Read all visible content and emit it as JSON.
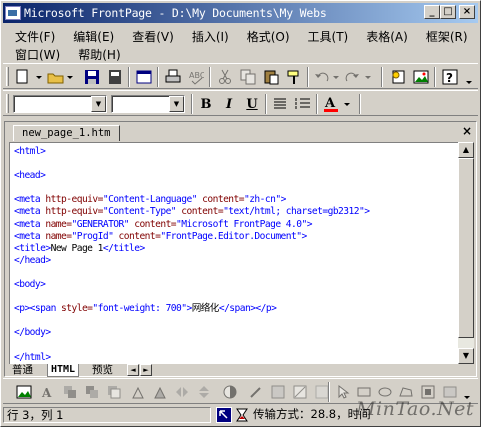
{
  "window": {
    "title": "Microsoft FrontPage - D:\\My Documents\\My Webs",
    "min_glyph": "_",
    "max_glyph": "□",
    "close_glyph": "×"
  },
  "menu": {
    "row1": [
      "文件(F)",
      "编辑(E)",
      "查看(V)",
      "插入(I)",
      "格式(O)",
      "工具(T)",
      "表格(A)",
      "框架(R)"
    ],
    "row2": [
      "窗口(W)",
      "帮助(H)"
    ]
  },
  "format_toolbar": {
    "style_value": "",
    "font_value": "",
    "bold": "B",
    "italic": "I",
    "underline": "U",
    "font_color_glyph": "A"
  },
  "document": {
    "tab_label": "new_page_1.htm",
    "close_glyph": "×",
    "code_lines": [
      [
        {
          "t": "tag",
          "v": "<html>"
        }
      ],
      [],
      [
        {
          "t": "tag",
          "v": "<head>"
        }
      ],
      [],
      [
        {
          "t": "tag",
          "v": "<meta "
        },
        {
          "t": "attr",
          "v": "http-equiv="
        },
        {
          "t": "val",
          "v": "\"Content-Language\""
        },
        {
          "t": "attr",
          "v": " content="
        },
        {
          "t": "val",
          "v": "\"zh-cn\""
        },
        {
          "t": "tag",
          "v": ">"
        }
      ],
      [
        {
          "t": "tag",
          "v": "<meta "
        },
        {
          "t": "attr",
          "v": "http-equiv="
        },
        {
          "t": "val",
          "v": "\"Content-Type\""
        },
        {
          "t": "attr",
          "v": " content="
        },
        {
          "t": "val",
          "v": "\"text/html; charset=gb2312\""
        },
        {
          "t": "tag",
          "v": ">"
        }
      ],
      [
        {
          "t": "tag",
          "v": "<meta "
        },
        {
          "t": "attr",
          "v": "name="
        },
        {
          "t": "val",
          "v": "\"GENERATOR\""
        },
        {
          "t": "attr",
          "v": " content="
        },
        {
          "t": "val",
          "v": "\"Microsoft FrontPage 4.0\""
        },
        {
          "t": "tag",
          "v": ">"
        }
      ],
      [
        {
          "t": "tag",
          "v": "<meta "
        },
        {
          "t": "attr",
          "v": "name="
        },
        {
          "t": "val",
          "v": "\"ProgId\""
        },
        {
          "t": "attr",
          "v": " content="
        },
        {
          "t": "val",
          "v": "\"FrontPage.Editor.Document\""
        },
        {
          "t": "tag",
          "v": ">"
        }
      ],
      [
        {
          "t": "tag",
          "v": "<title>"
        },
        {
          "t": "txt",
          "v": "New Page 1"
        },
        {
          "t": "tag",
          "v": "</title>"
        }
      ],
      [
        {
          "t": "tag",
          "v": "</head>"
        }
      ],
      [],
      [
        {
          "t": "tag",
          "v": "<body>"
        }
      ],
      [],
      [
        {
          "t": "tag",
          "v": "<p><span "
        },
        {
          "t": "attr",
          "v": "style="
        },
        {
          "t": "val",
          "v": "\"font-weight: 700\""
        },
        {
          "t": "tag",
          "v": ">"
        },
        {
          "t": "txt",
          "v": "网络化"
        },
        {
          "t": "tag",
          "v": "</span></p>"
        }
      ],
      [],
      [
        {
          "t": "tag",
          "v": "</body>"
        }
      ],
      [],
      [
        {
          "t": "tag",
          "v": "</html>"
        }
      ]
    ]
  },
  "view_tabs": {
    "normal": "普通",
    "html": "HTML",
    "preview": "预览"
  },
  "status": {
    "position": "行 3，列 1",
    "transfer": "传输方式：28.8，时间"
  },
  "watermark": "MinTao.Net",
  "colors": {
    "title_start": "#0a246a",
    "title_end": "#a6caf0",
    "tag": "#0000ff",
    "attr": "#800000",
    "face": "#d4d0c8"
  }
}
